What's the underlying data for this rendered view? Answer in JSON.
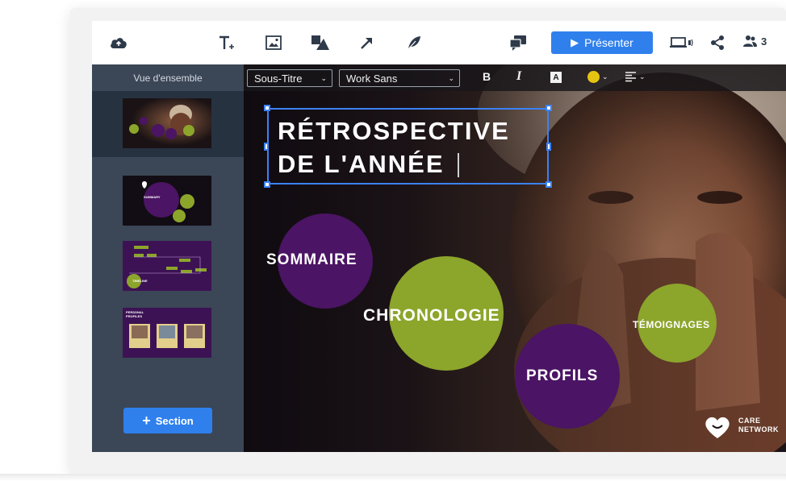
{
  "toolbar": {
    "present_label": "Présenter",
    "collaborators_count": "3",
    "icons": [
      "cloud-icon",
      "text-icon",
      "image-icon",
      "shapes-icon",
      "arrow-icon",
      "leaf-icon",
      "comment-icon",
      "play-icon",
      "device-preview-icon",
      "share-icon",
      "people-icon"
    ]
  },
  "sidebar": {
    "title": "Vue d'ensemble",
    "section_button_label": "Section",
    "thumbnails": [
      {
        "label": ""
      },
      {
        "label": "SUMMARY"
      },
      {
        "label": "TIMELINE"
      },
      {
        "label": "PERSONAL PROFILES"
      }
    ]
  },
  "format_bar": {
    "style_value": "Sous-Titre",
    "font_value": "Work Sans",
    "bold_label": "B",
    "italic_label": "I",
    "text_bg_label": "A",
    "text_color": "#e6c312"
  },
  "canvas": {
    "title_line1": "RÉTROSPECTIVE",
    "title_line2": "DE L'ANNÉE",
    "topics": [
      {
        "label": "SOMMAIRE",
        "color": "#4b1464"
      },
      {
        "label": "CHRONOLOGIE",
        "color": "#8ca52b"
      },
      {
        "label": "PROFILS",
        "color": "#4b1464"
      },
      {
        "label": "TÉMOIGNAGES",
        "color": "#8ca52b"
      }
    ],
    "logo_text_line1": "CARE",
    "logo_text_line2": "NETWORK"
  },
  "colors": {
    "accent": "#2f80ed",
    "sidebar_bg": "#3b4656",
    "purple": "#4b1464",
    "lime": "#8ca52b"
  }
}
